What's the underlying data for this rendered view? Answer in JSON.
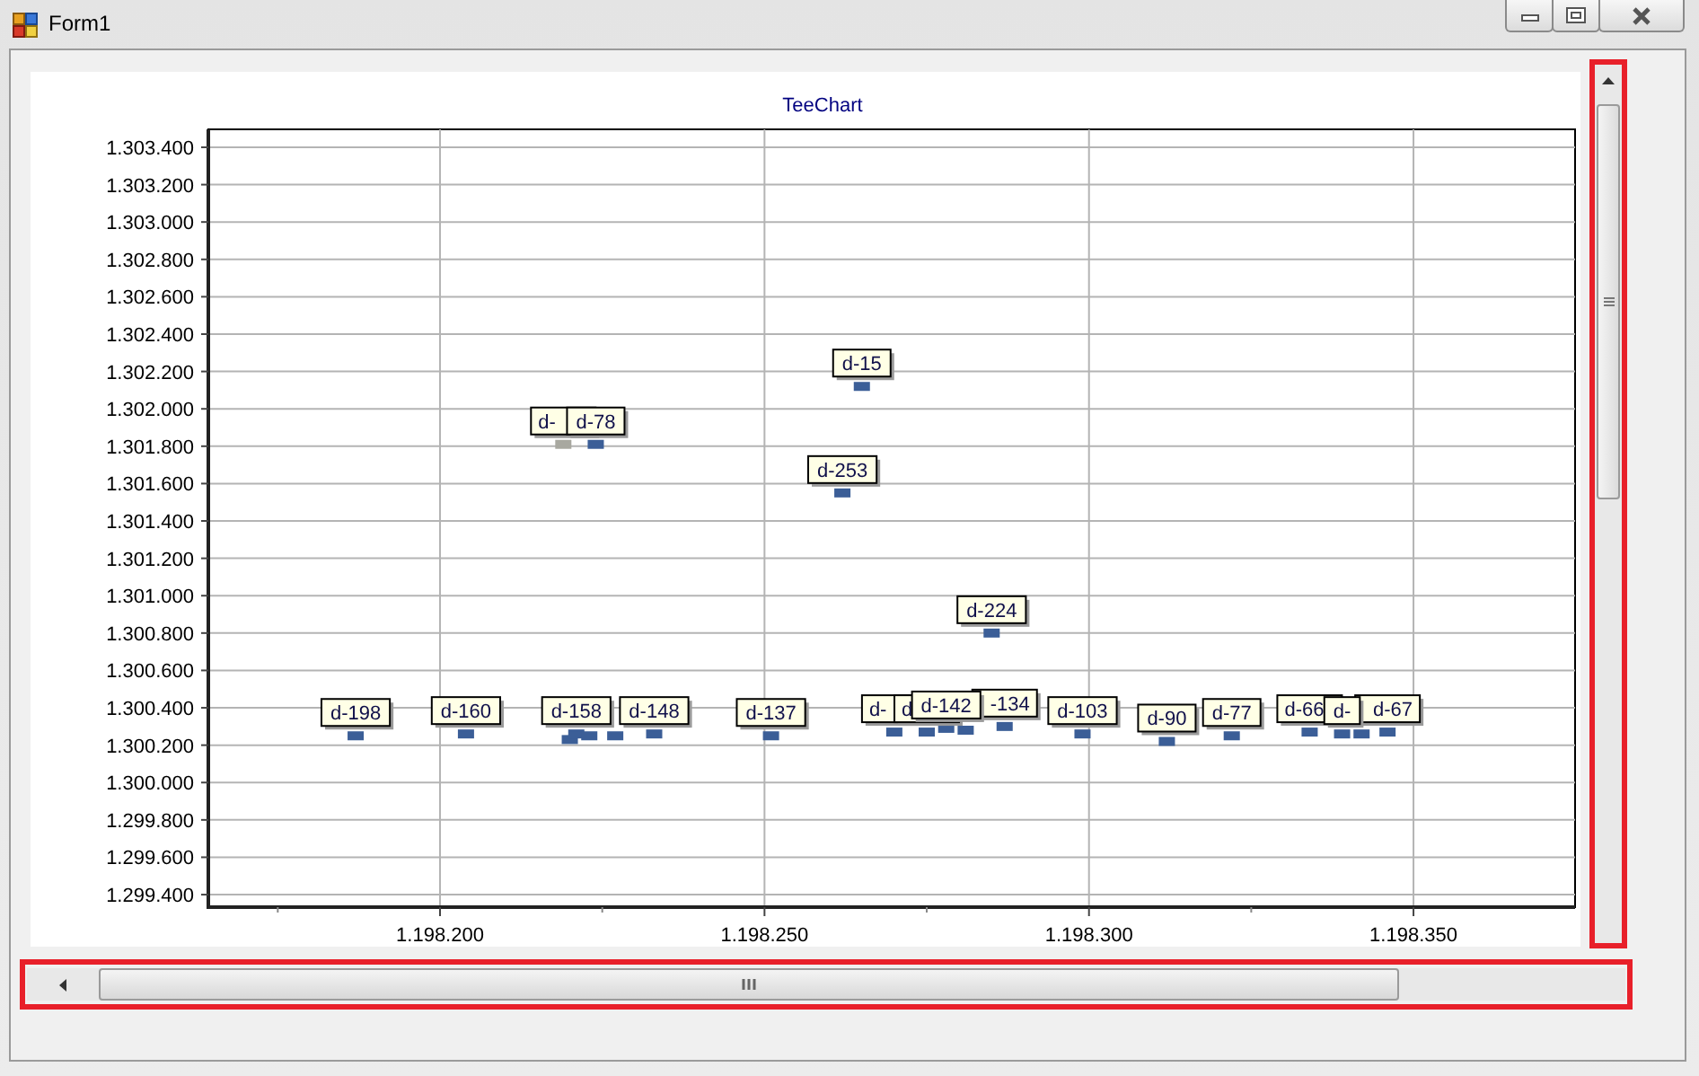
{
  "window": {
    "title": "Form1"
  },
  "chart": {
    "chart_data": {
      "type": "scatter",
      "title": "TeeChart",
      "grid": true,
      "xlim": [
        1198164.3,
        1198374.9
      ],
      "ylim": [
        1299333,
        1303496
      ],
      "xticks": [
        {
          "value": 1198200,
          "label": "1.198.200"
        },
        {
          "value": 1198250,
          "label": "1.198.250"
        },
        {
          "value": 1198300,
          "label": "1.198.300"
        },
        {
          "value": 1198350,
          "label": "1.198.350"
        }
      ],
      "yticks": [
        {
          "value": 1299400,
          "label": "1.299.400"
        },
        {
          "value": 1299600,
          "label": "1.299.600"
        },
        {
          "value": 1299800,
          "label": "1.299.800"
        },
        {
          "value": 1300000,
          "label": "1.300.000"
        },
        {
          "value": 1300200,
          "label": "1.300.200"
        },
        {
          "value": 1300400,
          "label": "1.300.400"
        },
        {
          "value": 1300600,
          "label": "1.300.600"
        },
        {
          "value": 1300800,
          "label": "1.300.800"
        },
        {
          "value": 1301000,
          "label": "1.301.000"
        },
        {
          "value": 1301200,
          "label": "1.301.200"
        },
        {
          "value": 1301400,
          "label": "1.301.400"
        },
        {
          "value": 1301600,
          "label": "1.301.600"
        },
        {
          "value": 1301800,
          "label": "1.301.800"
        },
        {
          "value": 1302000,
          "label": "1.302.000"
        },
        {
          "value": 1302200,
          "label": "1.302.200"
        },
        {
          "value": 1302400,
          "label": "1.302.400"
        },
        {
          "value": 1302600,
          "label": "1.302.600"
        },
        {
          "value": 1302800,
          "label": "1.302.800"
        },
        {
          "value": 1303000,
          "label": "1.303.000"
        },
        {
          "value": 1303200,
          "label": "1.303.200"
        },
        {
          "value": 1303400,
          "label": "1.303.400"
        }
      ],
      "series": [
        {
          "color": "#3b5e97",
          "x": [
            1198187,
            1198204,
            1198220,
            1198221,
            1198223,
            1198224,
            1198227,
            1198233,
            1198251,
            1198262,
            1198265,
            1198270,
            1198275,
            1198278,
            1198281,
            1198285,
            1198287,
            1198299,
            1198312,
            1198322,
            1198334,
            1198339,
            1198342,
            1198346
          ],
          "values": [
            1300250,
            1300260,
            1300230,
            1300260,
            1300250,
            1301810,
            1300250,
            1300260,
            1300250,
            1301550,
            1302120,
            1300270,
            1300270,
            1300290,
            1300280,
            1300800,
            1300300,
            1300260,
            1300220,
            1300250,
            1300270,
            1300260,
            1300260,
            1300270
          ]
        },
        {
          "color": "#a8a8a0",
          "x": [
            1198219
          ],
          "values": [
            1301810
          ]
        }
      ],
      "annotations": [
        {
          "x": 1198219,
          "y": 1301810,
          "text": "d-"
        },
        {
          "x": 1198224,
          "y": 1301810,
          "text": "d-78"
        },
        {
          "x": 1198187,
          "y": 1300250,
          "text": "d-198"
        },
        {
          "x": 1198204,
          "y": 1300260,
          "text": "d-160"
        },
        {
          "x": 1198221,
          "y": 1300260,
          "text": "d-158"
        },
        {
          "x": 1198233,
          "y": 1300260,
          "text": "d-148"
        },
        {
          "x": 1198251,
          "y": 1300250,
          "text": "d-137"
        },
        {
          "x": 1198265,
          "y": 1302120,
          "text": "d-15"
        },
        {
          "x": 1198262,
          "y": 1301550,
          "text": "d-253"
        },
        {
          "x": 1198285,
          "y": 1300800,
          "text": "d-224"
        },
        {
          "x": 1198270,
          "y": 1300270,
          "text": "d-"
        },
        {
          "x": 1198275,
          "y": 1300270,
          "text": "d"
        },
        {
          "x": 1198287,
          "y": 1300300,
          "text": "-134"
        },
        {
          "x": 1198278,
          "y": 1300290,
          "text": "d-142"
        },
        {
          "x": 1198299,
          "y": 1300260,
          "text": "d-103"
        },
        {
          "x": 1198312,
          "y": 1300220,
          "text": "d-90"
        },
        {
          "x": 1198322,
          "y": 1300250,
          "text": "d-77"
        },
        {
          "x": 1198334,
          "y": 1300270,
          "text": "d-66"
        },
        {
          "x": 1198346,
          "y": 1300270,
          "text": "d-67"
        },
        {
          "x": 1198339,
          "y": 1300260,
          "text": "d-"
        }
      ]
    }
  }
}
